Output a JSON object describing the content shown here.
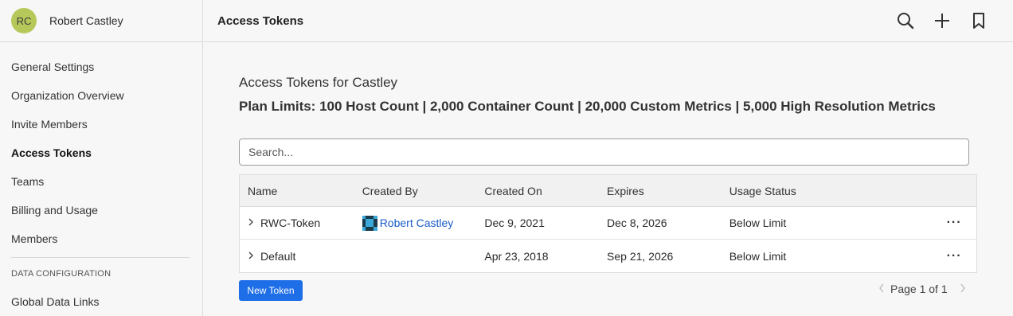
{
  "user": {
    "initials": "RC",
    "name": "Robert Castley"
  },
  "sidebar": {
    "items": [
      {
        "label": "General Settings",
        "active": false
      },
      {
        "label": "Organization Overview",
        "active": false
      },
      {
        "label": "Invite Members",
        "active": false
      },
      {
        "label": "Access Tokens",
        "active": true
      },
      {
        "label": "Teams",
        "active": false
      },
      {
        "label": "Billing and Usage",
        "active": false
      },
      {
        "label": "Members",
        "active": false
      }
    ],
    "section_label": "DATA CONFIGURATION",
    "section_items": [
      {
        "label": "Global Data Links"
      }
    ]
  },
  "header": {
    "title": "Access Tokens",
    "icons": [
      "search-icon",
      "plus-icon",
      "bookmark-icon"
    ]
  },
  "main": {
    "heading": "Access Tokens for Castley",
    "plan_limits": "Plan Limits: 100 Host Count | 2,000 Container Count | 20,000 Custom Metrics | 5,000 High Resolution Metrics",
    "search_placeholder": "Search..."
  },
  "table": {
    "columns": [
      "Name",
      "Created By",
      "Created On",
      "Expires",
      "Usage Status"
    ],
    "rows": [
      {
        "name": "RWC-Token",
        "created_by": "Robert Castley",
        "created_on": "Dec 9, 2021",
        "expires": "Dec 8, 2026",
        "usage_status": "Below Limit",
        "actions": "···"
      },
      {
        "name": "Default",
        "created_by": "",
        "created_on": "Apr 23, 2018",
        "expires": "Sep 21, 2026",
        "usage_status": "Below Limit",
        "actions": "···"
      }
    ]
  },
  "actions": {
    "new_token_label": "New Token"
  },
  "pagination": {
    "text": "Page 1 of 1"
  },
  "colors": {
    "accent": "#1e6ee8",
    "link": "#1a5cc8",
    "avatar": "#b7c85a"
  }
}
